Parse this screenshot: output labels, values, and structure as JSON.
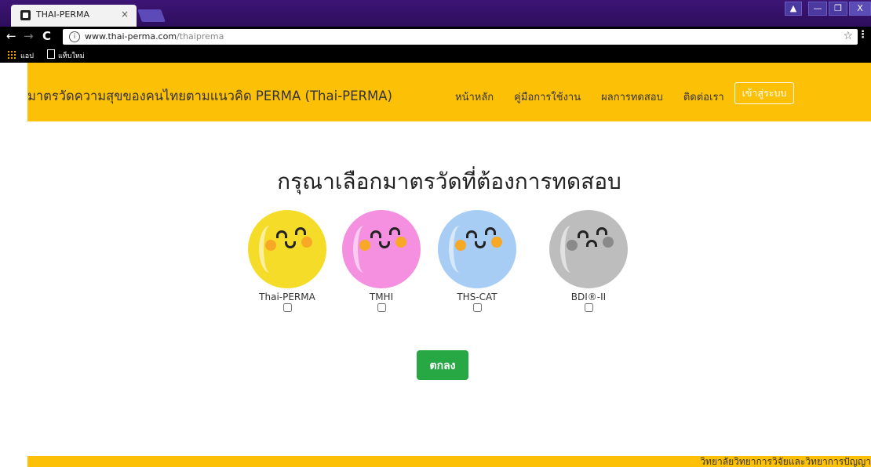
{
  "browser": {
    "tab_title": "THAI-PERMA",
    "tab_close": "×",
    "url_host": "www.thai-perma.com",
    "url_path": "/thaiprema",
    "bookmarks": [
      {
        "label": "แอป",
        "icon": "apps-icon"
      },
      {
        "label": "แท็บใหม่",
        "icon": "page-icon"
      }
    ],
    "window_buttons": [
      "▲",
      "—",
      "❐",
      "X"
    ]
  },
  "header": {
    "brand": "มาตรวัดความสุขของคนไทยตามแนวคิด PERMA (Thai-PERMA)",
    "nav": [
      "หน้าหลัก",
      "คู่มือการใช้งาน",
      "ผลการทดสอบ",
      "ติดต่อเรา"
    ],
    "login": "เข้าสู่ระบบ",
    "background": "#fcc007"
  },
  "main": {
    "heading": "กรุณาเลือกมาตรวัดที่ต้องการทดสอบ",
    "options": [
      {
        "label": "Thai-PERMA",
        "color": "#f5dc28",
        "mood": "happy",
        "checked": false
      },
      {
        "label": "TMHI",
        "color": "#f58fdf",
        "mood": "happy",
        "checked": false
      },
      {
        "label": "THS-CAT",
        "color": "#a8cdf5",
        "mood": "happy",
        "checked": false
      },
      {
        "label": "BDI®-II",
        "color": "#bdbdbd",
        "mood": "sad",
        "checked": false
      }
    ],
    "submit": "ตกลง",
    "submit_color": "#28a745"
  },
  "footer": {
    "text": "วิทยาลัยวิทยาการวิจัยและวิทยาการปัญญา"
  }
}
